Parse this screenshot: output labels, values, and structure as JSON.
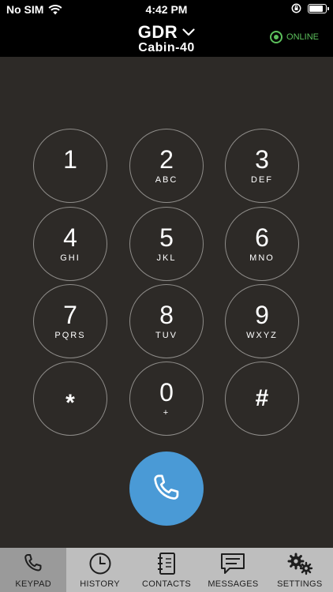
{
  "status_bar": {
    "carrier": "No SIM",
    "time": "4:42 PM",
    "battery_level": 0.9
  },
  "header": {
    "title": "GDR",
    "subtitle": "Cabin-40",
    "status": "ONLINE",
    "status_color": "#5cc05c"
  },
  "keypad": {
    "keys": [
      {
        "digit": "1",
        "letters": ""
      },
      {
        "digit": "2",
        "letters": "ABC"
      },
      {
        "digit": "3",
        "letters": "DEF"
      },
      {
        "digit": "4",
        "letters": "GHI"
      },
      {
        "digit": "5",
        "letters": "JKL"
      },
      {
        "digit": "6",
        "letters": "MNO"
      },
      {
        "digit": "7",
        "letters": "PQRS"
      },
      {
        "digit": "8",
        "letters": "TUV"
      },
      {
        "digit": "9",
        "letters": "WXYZ"
      },
      {
        "digit": "*",
        "letters": ""
      },
      {
        "digit": "0",
        "letters": "+"
      },
      {
        "digit": "#",
        "letters": ""
      }
    ],
    "call_icon": "phone-icon",
    "call_color": "#4a9ad6"
  },
  "tabs": [
    {
      "label": "KEYPAD",
      "icon": "phone-icon",
      "active": true
    },
    {
      "label": "HISTORY",
      "icon": "clock-icon",
      "active": false
    },
    {
      "label": "CONTACTS",
      "icon": "address-book-icon",
      "active": false
    },
    {
      "label": "MESSAGES",
      "icon": "message-icon",
      "active": false
    },
    {
      "label": "SETTINGS",
      "icon": "gears-icon",
      "active": false
    }
  ]
}
